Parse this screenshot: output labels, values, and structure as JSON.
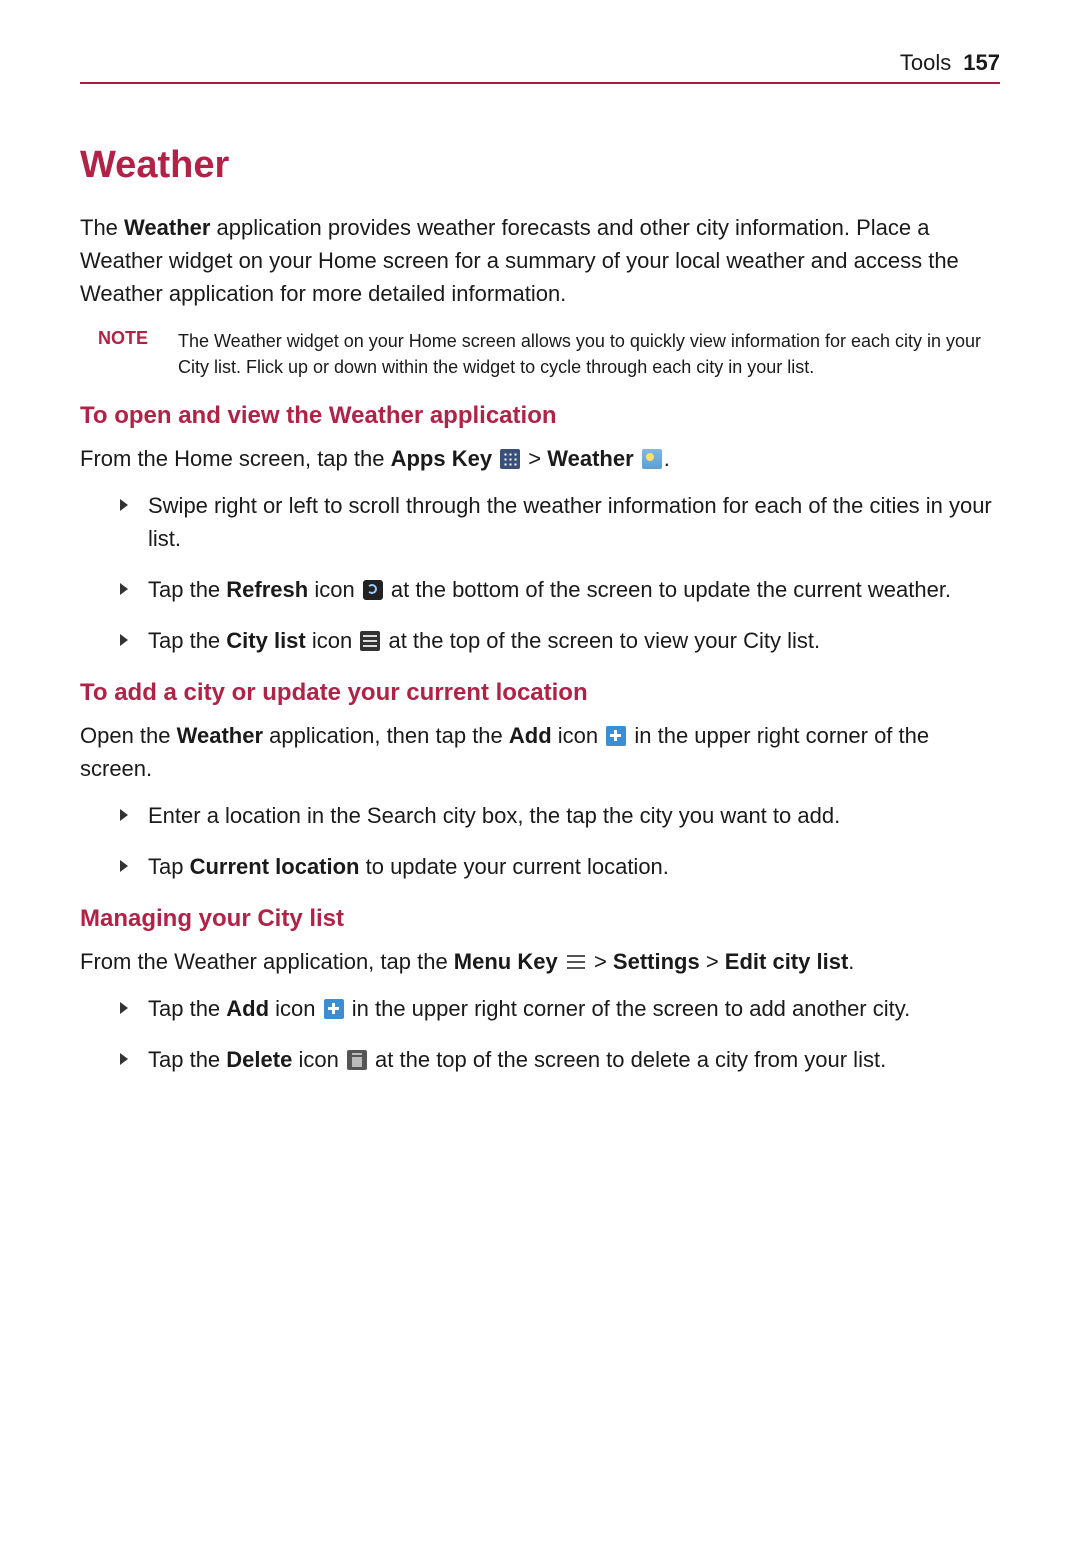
{
  "header": {
    "section": "Tools",
    "page": "157"
  },
  "title": "Weather",
  "intro": {
    "pre": "The ",
    "bold": "Weather",
    "post": " application provides weather forecasts and other city information. Place a Weather widget on your Home screen for a summary of your local weather and access the Weather application for more detailed information."
  },
  "note": {
    "label": "NOTE",
    "text": "The Weather widget on your Home screen allows you to quickly view information for each city in your City list. Flick up or down within the widget to cycle through each city in your list."
  },
  "sec1": {
    "heading": "To open and view the Weather application",
    "line_pre": "From the Home screen, tap the ",
    "apps_key": "Apps Key",
    "sep1": " > ",
    "weather": "Weather",
    "end": ".",
    "b1": "Swipe right or left to scroll through the weather information for each of the cities in your list.",
    "b2_pre": "Tap the ",
    "b2_bold": "Refresh",
    "b2_mid": " icon ",
    "b2_post": " at the bottom of the screen to update the current weather.",
    "b3_pre": "Tap the ",
    "b3_bold": "City list",
    "b3_mid": " icon ",
    "b3_post": " at the top of the screen to view your City list."
  },
  "sec2": {
    "heading": "To add a city or update your current location",
    "line_pre": "Open the ",
    "bold": "Weather",
    "line_mid": " application, then tap the ",
    "add": "Add",
    "line_mid2": " icon ",
    "line_post": " in the upper right corner of the screen.",
    "b1": "Enter a location in the Search city box, the tap the city you want to add.",
    "b2_pre": "Tap ",
    "b2_bold": "Current location",
    "b2_post": " to update your current location."
  },
  "sec3": {
    "heading": "Managing your City list",
    "line_pre": "From the Weather application, tap the ",
    "menu": "Menu Key",
    "sep": " > ",
    "settings": "Settings",
    "editcity": "Edit city list",
    "end": ".",
    "b1_pre": "Tap the ",
    "b1_bold": "Add",
    "b1_mid": " icon ",
    "b1_post": " in the upper right corner of the screen to add another city.",
    "b2_pre": "Tap the ",
    "b2_bold": "Delete",
    "b2_mid": " icon ",
    "b2_post": " at the top of the screen to delete a city from your list."
  }
}
